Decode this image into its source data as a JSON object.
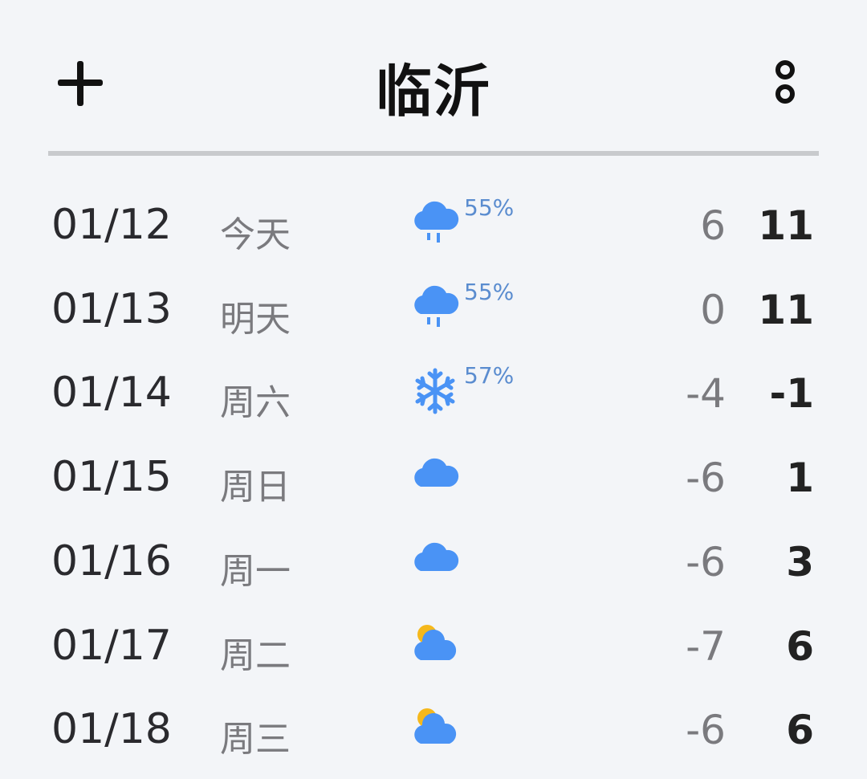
{
  "header": {
    "title": "临沂",
    "add_icon": "plus-icon",
    "more_icon": "more-vertical-icon"
  },
  "colors": {
    "background": "#f3f5f8",
    "cloud": "#4a93f5",
    "sun": "#f5b81c",
    "precip_text": "#5a8ccf",
    "divider": "#c8cacd"
  },
  "forecast": [
    {
      "date": "01/12",
      "day": "今天",
      "icon": "rain-icon",
      "precip": "55%",
      "low": "6",
      "high": "11"
    },
    {
      "date": "01/13",
      "day": "明天",
      "icon": "rain-icon",
      "precip": "55%",
      "low": "0",
      "high": "11"
    },
    {
      "date": "01/14",
      "day": "周六",
      "icon": "snow-icon",
      "precip": "57%",
      "low": "-4",
      "high": "-1"
    },
    {
      "date": "01/15",
      "day": "周日",
      "icon": "cloud-icon",
      "precip": "",
      "low": "-6",
      "high": "1"
    },
    {
      "date": "01/16",
      "day": "周一",
      "icon": "cloud-icon",
      "precip": "",
      "low": "-6",
      "high": "3"
    },
    {
      "date": "01/17",
      "day": "周二",
      "icon": "partly-cloudy-icon",
      "precip": "",
      "low": "-7",
      "high": "6"
    },
    {
      "date": "01/18",
      "day": "周三",
      "icon": "partly-cloudy-icon",
      "precip": "",
      "low": "-6",
      "high": "6"
    }
  ]
}
